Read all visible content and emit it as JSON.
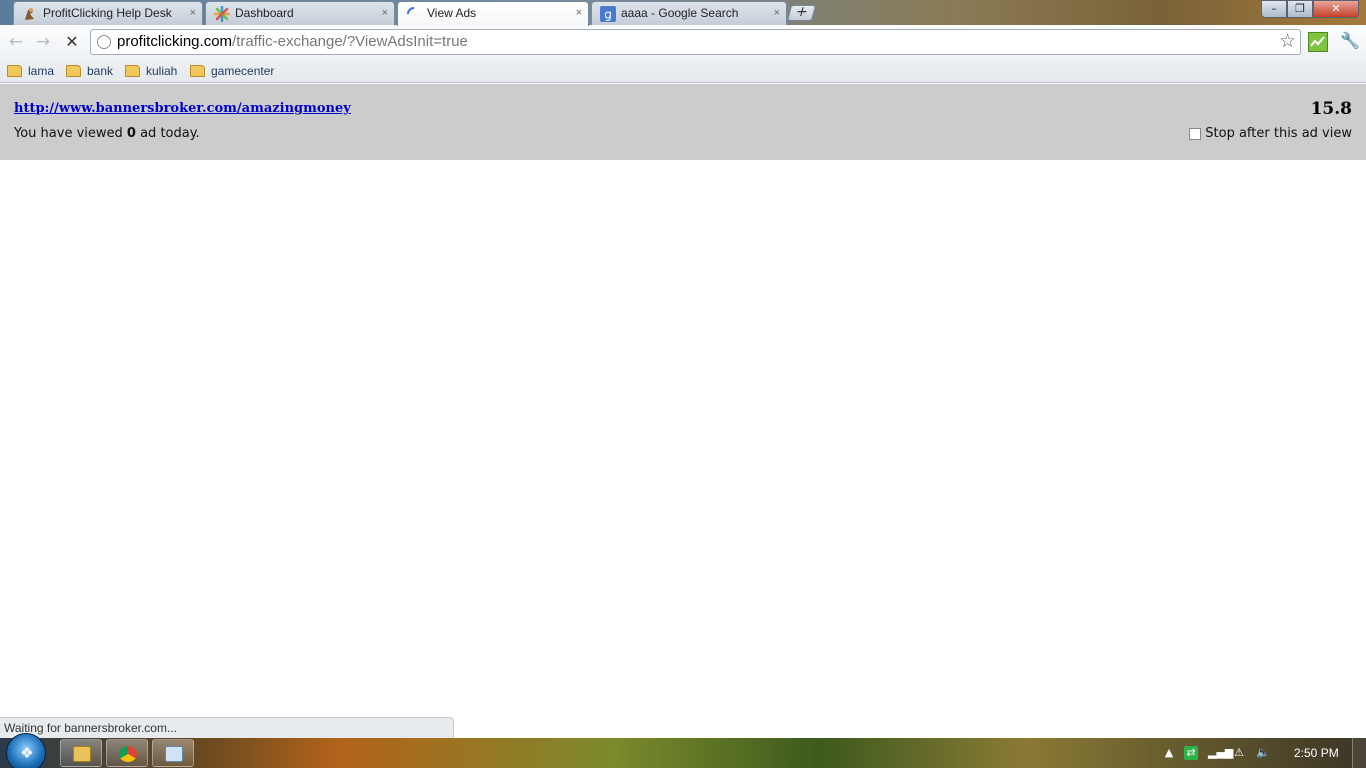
{
  "tabs": [
    {
      "title": "ProfitClicking Help Desk",
      "icon": "profitclicking-favicon"
    },
    {
      "title": "Dashboard",
      "icon": "dashboard-favicon"
    },
    {
      "title": "View Ads",
      "icon": "loading-spinner"
    },
    {
      "title": "aaaa - Google Search",
      "icon": "google-favicon"
    }
  ],
  "tab_close_glyph": "×",
  "new_tab_glyph": "+",
  "window_controls": {
    "minimize": "–",
    "maximize": "❐",
    "close": "✕"
  },
  "toolbar": {
    "back_glyph": "←",
    "forward_glyph": "→",
    "stop_glyph": "✕",
    "url_host": "profitclicking.com",
    "url_path": "/traffic-exchange/?ViewAdsInit=true",
    "star_glyph": "☆",
    "wrench_glyph": "🔧"
  },
  "bookmarks": [
    {
      "label": "lama"
    },
    {
      "label": "bank"
    },
    {
      "label": "kuliah"
    },
    {
      "label": "gamecenter"
    }
  ],
  "page": {
    "ad_url": "http://www.bannersbroker.com/amazingmoney",
    "timer": "15.8",
    "viewed_prefix": "You have viewed",
    "viewed_count": "0",
    "viewed_suffix": "ad today.",
    "stop_label": "Stop after this ad view",
    "stop_checked": false
  },
  "status_bar": "Waiting for bannersbroker.com...",
  "taskbar": {
    "apps": [
      "windows-explorer",
      "google-chrome",
      "notepad"
    ],
    "clock": "2:50 PM"
  },
  "colors": {
    "ad_bar_bg": "#cccccc",
    "link": "#0000cc"
  }
}
